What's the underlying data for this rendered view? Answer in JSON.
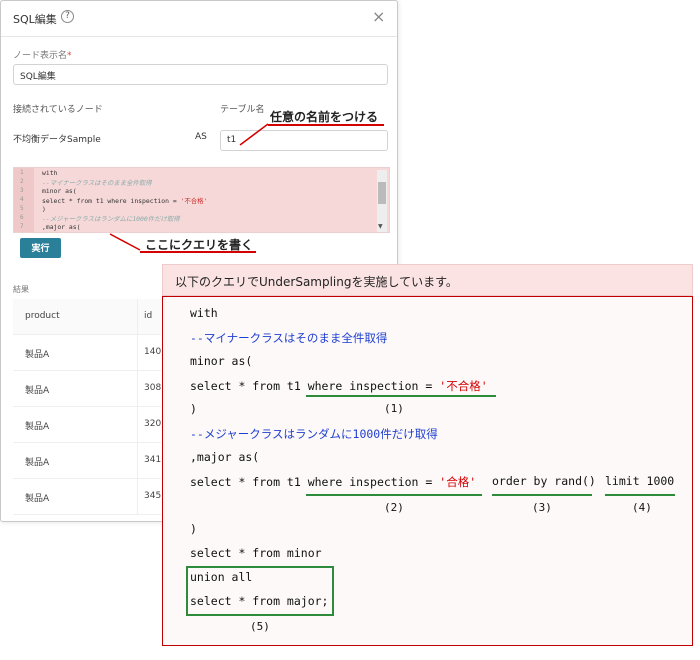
{
  "dialog": {
    "title": "SQL編集",
    "help_icon": "?",
    "close_icon": "×",
    "node_label": "ノード表示名",
    "required_mark": "*",
    "node_value": "SQL編集",
    "connected_label": "接続されているノード",
    "table_label": "テーブル名",
    "source_node": "不均衡データSample",
    "as_text": "AS",
    "alias_value": "t1",
    "editor": {
      "line_numbers": [
        "1",
        "2",
        "3",
        "4",
        "5",
        "6",
        "7"
      ],
      "lines": [
        "with",
        "--マイナークラスはそのまま全件取得",
        " minor as(",
        "select * from t1 where inspection = ",
        ")",
        "--メジャークラスはランダムに1000件だけ取得",
        ",major as("
      ],
      "line4_string": "'不合格'"
    },
    "run_button": "実行",
    "results_label": "結果",
    "results": {
      "headers": [
        "product",
        "id"
      ],
      "rows": [
        [
          "製品A",
          "140"
        ],
        [
          "製品A",
          "308"
        ],
        [
          "製品A",
          "320"
        ],
        [
          "製品A",
          "341"
        ],
        [
          "製品A",
          "345"
        ]
      ]
    }
  },
  "annotations": {
    "alias_note": "任意の名前をつける",
    "query_note": "ここにクエリを書く"
  },
  "explanation": {
    "header": "以下のクエリでUnderSamplingを実施しています。",
    "line_with": "with",
    "comment_minor": "--マイナークラスはそのまま全件取得",
    "minor_as": " minor as(",
    "minor_select_prefix": "select * from t1 ",
    "minor_where": "where inspection = ",
    "minor_value": "'不合格'",
    "close1": ")",
    "mark1": "(1)",
    "comment_major": "--メジャークラスはランダムに1000件だけ取得",
    "major_as": ",major as(",
    "major_select_prefix": "select * from t1 ",
    "major_where": "where inspection = ",
    "major_value": "'合格'",
    "major_order": "order by rand()",
    "major_limit": "limit 1000",
    "mark2": "(2)",
    "mark3": "(3)",
    "mark4": "(4)",
    "close2": ")",
    "select_minor": "select * from minor",
    "union_all": "union all",
    "select_major": "select * from major;",
    "mark5": "(5)"
  }
}
